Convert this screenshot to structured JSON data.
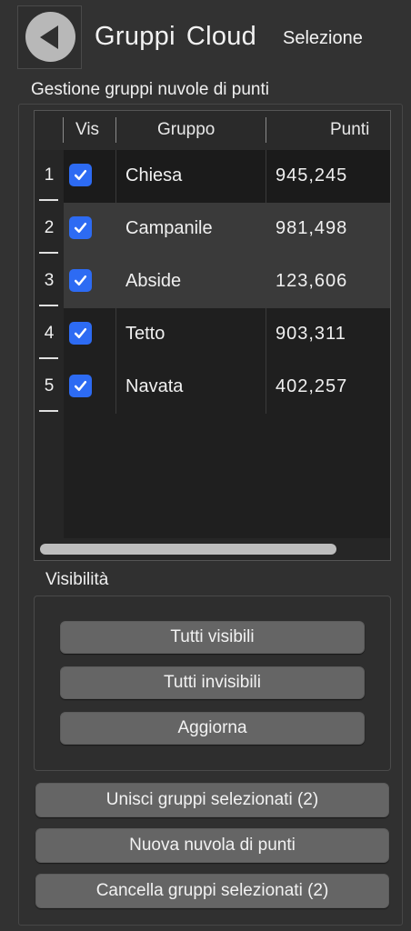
{
  "header": {
    "back_icon": "back-arrow-icon",
    "title_word1": "Gruppi",
    "title_word2": "Cloud",
    "subtitle": "Selezione"
  },
  "groups_section": {
    "label": "Gestione gruppi  nuvole di punti",
    "columns": [
      "Vis",
      "Gruppo",
      "Punti"
    ],
    "rows": [
      {
        "num": "1",
        "visible": true,
        "name": "Chiesa",
        "points": "945,245"
      },
      {
        "num": "2",
        "visible": true,
        "name": "Campanile",
        "points": "981,498"
      },
      {
        "num": "3",
        "visible": true,
        "name": "Abside",
        "points": "123,606"
      },
      {
        "num": "4",
        "visible": true,
        "name": "Tetto",
        "points": "903,311"
      },
      {
        "num": "5",
        "visible": true,
        "name": "Navata",
        "points": "402,257"
      }
    ]
  },
  "visibility": {
    "label": "Visibilità",
    "all_visible": "Tutti visibili",
    "all_invisible": "Tutti invisibili",
    "refresh": "Aggiorna"
  },
  "actions": {
    "merge": "Unisci gruppi selezionati (2)",
    "new_cloud": "Nuova nuvola di punti",
    "delete": "Cancella gruppi selezionati (2)"
  },
  "colors": {
    "checkbox_accent": "#2d6bf3",
    "background": "#323232"
  }
}
